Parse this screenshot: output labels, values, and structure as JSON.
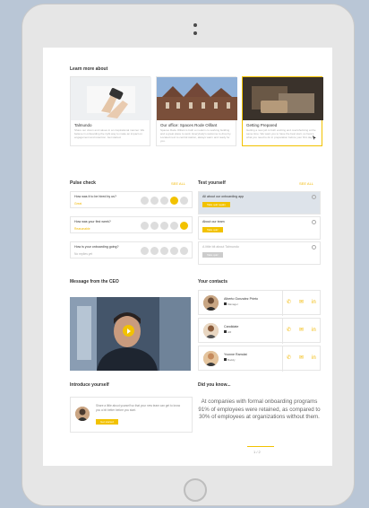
{
  "learn": {
    "title": "Learn more about",
    "cards": [
      {
        "title": "Talmundo",
        "desc": "Share our vision and values in an inspirational manner. We believe in onboarding the right way to make an impact on engagement and retention. Get started."
      },
      {
        "title": "Our office: Spaces Rode Olifant",
        "desc": "Spaces Rode Olifant is both a modern co-working building and a great place to work. Everybody's welcome to drop by. Located next to central station, always warm and ready for you."
      },
      {
        "title": "Getting Prepared",
        "desc": "Getting a new job is both exciting and overwhelming at the same time. We want you to have the best start, so here's what you need to do in preparation before your first day."
      }
    ]
  },
  "pulse": {
    "title": "Pulse check",
    "see_all": "SEE ALL",
    "rows": [
      {
        "question": "How was it to be hired by us?",
        "answer": "Great",
        "selected": 3
      },
      {
        "question": "How was your first week?",
        "answer": "Reasonable",
        "selected": 4
      },
      {
        "question": "How is your onboarding going?",
        "answer": "No replies yet",
        "selected": -1
      }
    ]
  },
  "test": {
    "title": "Test yourself",
    "see_all": "SEE ALL",
    "rows": [
      {
        "title": "All about our onboarding app",
        "button": "Take quiz again"
      },
      {
        "title": "About our team",
        "button": "Take quiz"
      },
      {
        "title": "A little bit about Talmundo",
        "button": "Take quiz"
      }
    ]
  },
  "ceo": {
    "title": "Message from the CEO"
  },
  "contacts": {
    "title": "Your contacts",
    "items": [
      {
        "name": "Alberto Gonzalez Prieto",
        "role": "Manager"
      },
      {
        "name": "Candidate",
        "role": "HR"
      },
      {
        "name": "Yvonne Ramdat",
        "role": "Buddy"
      }
    ]
  },
  "intro": {
    "title": "Introduce yourself",
    "text": "Share a little about yourself so that your new team can get to know you a bit better before you start.",
    "button": "Get started"
  },
  "didyou": {
    "title": "Did you know...",
    "text": "At companies with formal onboarding programs 91% of employees were retained, as compared to 30% of employees at organizations without them.",
    "pager": "1 / 2"
  },
  "colors": {
    "accent": "#f2c200",
    "border": "#e6e6e6",
    "background": "#b9c6d6"
  }
}
